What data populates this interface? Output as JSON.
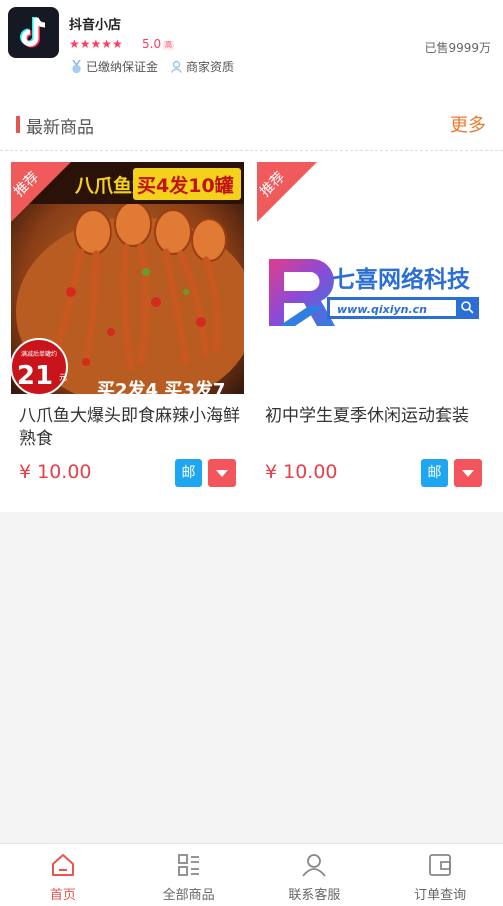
{
  "shop": {
    "name": "抖音小店",
    "stars": "★★★★★",
    "rating": "5.0",
    "rating_tag": "高",
    "sold": "已售9999万",
    "badges": [
      "已缴纳保证金",
      "商家资质"
    ]
  },
  "section": {
    "title": "最新商品",
    "more": "更多"
  },
  "products": [
    {
      "ribbon": "推荐",
      "title": "八爪鱼大爆头即食麻辣小海鲜熟食",
      "price": "¥ 10.00",
      "mail_label": "邮",
      "banner": {
        "left": "八爪鱼大爆头",
        "right": "买4发10罐"
      },
      "promo_small": "满减后单罐约",
      "promo_price": "21",
      "promo_unit": "元",
      "bottom_text": "买2发4 买3发7"
    },
    {
      "ribbon": "推荐",
      "title": "初中学生夏季休闲运动套装",
      "price": "¥ 10.00",
      "mail_label": "邮",
      "brand_name": "七喜网络科技",
      "brand_url": "www.qixiyn.cn"
    }
  ],
  "tabs": [
    {
      "label": "首页",
      "icon": "home-icon",
      "active": true
    },
    {
      "label": "全部商品",
      "icon": "list-icon",
      "active": false
    },
    {
      "label": "联系客服",
      "icon": "user-icon",
      "active": false
    },
    {
      "label": "订单查询",
      "icon": "wallet-icon",
      "active": false
    }
  ],
  "colors": {
    "accent": "#e8554e",
    "price": "#e8404a",
    "more": "#f0782d",
    "mail": "#1ea7f0"
  }
}
